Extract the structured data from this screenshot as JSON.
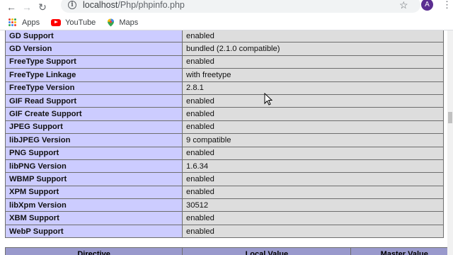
{
  "browser": {
    "url_host": "localhost",
    "url_path": "/Php/phpinfo.php",
    "avatar_letter": "A",
    "bookmarks": [
      {
        "label": "Apps",
        "icon": "apps-icon"
      },
      {
        "label": "YouTube",
        "icon": "youtube-icon"
      },
      {
        "label": "Maps",
        "icon": "maps-icon"
      }
    ]
  },
  "gd_table": {
    "rows": [
      {
        "directive": "GD Support",
        "value": "enabled"
      },
      {
        "directive": "GD Version",
        "value": "bundled (2.1.0 compatible)"
      },
      {
        "directive": "FreeType Support",
        "value": "enabled"
      },
      {
        "directive": "FreeType Linkage",
        "value": "with freetype"
      },
      {
        "directive": "FreeType Version",
        "value": "2.8.1"
      },
      {
        "directive": "GIF Read Support",
        "value": "enabled"
      },
      {
        "directive": "GIF Create Support",
        "value": "enabled"
      },
      {
        "directive": "JPEG Support",
        "value": "enabled"
      },
      {
        "directive": "libJPEG Version",
        "value": "9 compatible"
      },
      {
        "directive": "PNG Support",
        "value": "enabled"
      },
      {
        "directive": "libPNG Version",
        "value": "1.6.34"
      },
      {
        "directive": "WBMP Support",
        "value": "enabled"
      },
      {
        "directive": "XPM Support",
        "value": "enabled"
      },
      {
        "directive": "libXpm Version",
        "value": "30512"
      },
      {
        "directive": "XBM Support",
        "value": "enabled"
      },
      {
        "directive": "WebP Support",
        "value": "enabled"
      }
    ]
  },
  "directive_header": {
    "col1": "Directive",
    "col2": "Local Value",
    "col3": "Master Value"
  },
  "colors": {
    "label_cell": "#ccccff",
    "value_cell": "#dddddd",
    "header_row": "#9999cc"
  }
}
